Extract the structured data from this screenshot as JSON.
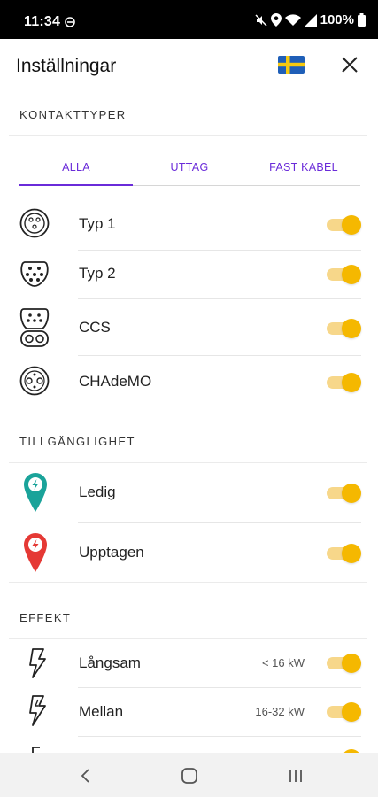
{
  "status_bar": {
    "time": "11:34",
    "battery": "100%"
  },
  "header": {
    "title": "Inställningar",
    "flag": "sweden-flag-icon",
    "close": "close-icon"
  },
  "connector_types": {
    "heading": "KONTAKTTYPER",
    "tabs": [
      {
        "label": "ALLA",
        "active": true
      },
      {
        "label": "UTTAG",
        "active": false
      },
      {
        "label": "FAST KABEL",
        "active": false
      }
    ],
    "items": [
      {
        "label": "Typ 1",
        "icon": "type1-connector-icon",
        "enabled": true
      },
      {
        "label": "Typ 2",
        "icon": "type2-connector-icon",
        "enabled": true
      },
      {
        "label": "CCS",
        "icon": "ccs-connector-icon",
        "enabled": true
      },
      {
        "label": "CHAdeMO",
        "icon": "chademo-connector-icon",
        "enabled": true
      }
    ]
  },
  "availability": {
    "heading": "TILLGÄNGLIGHET",
    "items": [
      {
        "label": "Ledig",
        "icon": "available-pin-icon",
        "color": "#1aa39a",
        "enabled": true
      },
      {
        "label": "Upptagen",
        "icon": "occupied-pin-icon",
        "color": "#e53935",
        "enabled": true
      }
    ]
  },
  "power": {
    "heading": "EFFEKT",
    "items": [
      {
        "label": "Långsam",
        "value": "< 16 kW",
        "icon": "slow-charge-bolt-icon",
        "enabled": true
      },
      {
        "label": "Mellan",
        "value": "16-32 kW",
        "icon": "medium-charge-bolt-icon",
        "enabled": true
      }
    ]
  },
  "colors": {
    "accent": "#6a2bd9",
    "toggle_on": "#f5b800",
    "toggle_track": "#f7d78a"
  }
}
